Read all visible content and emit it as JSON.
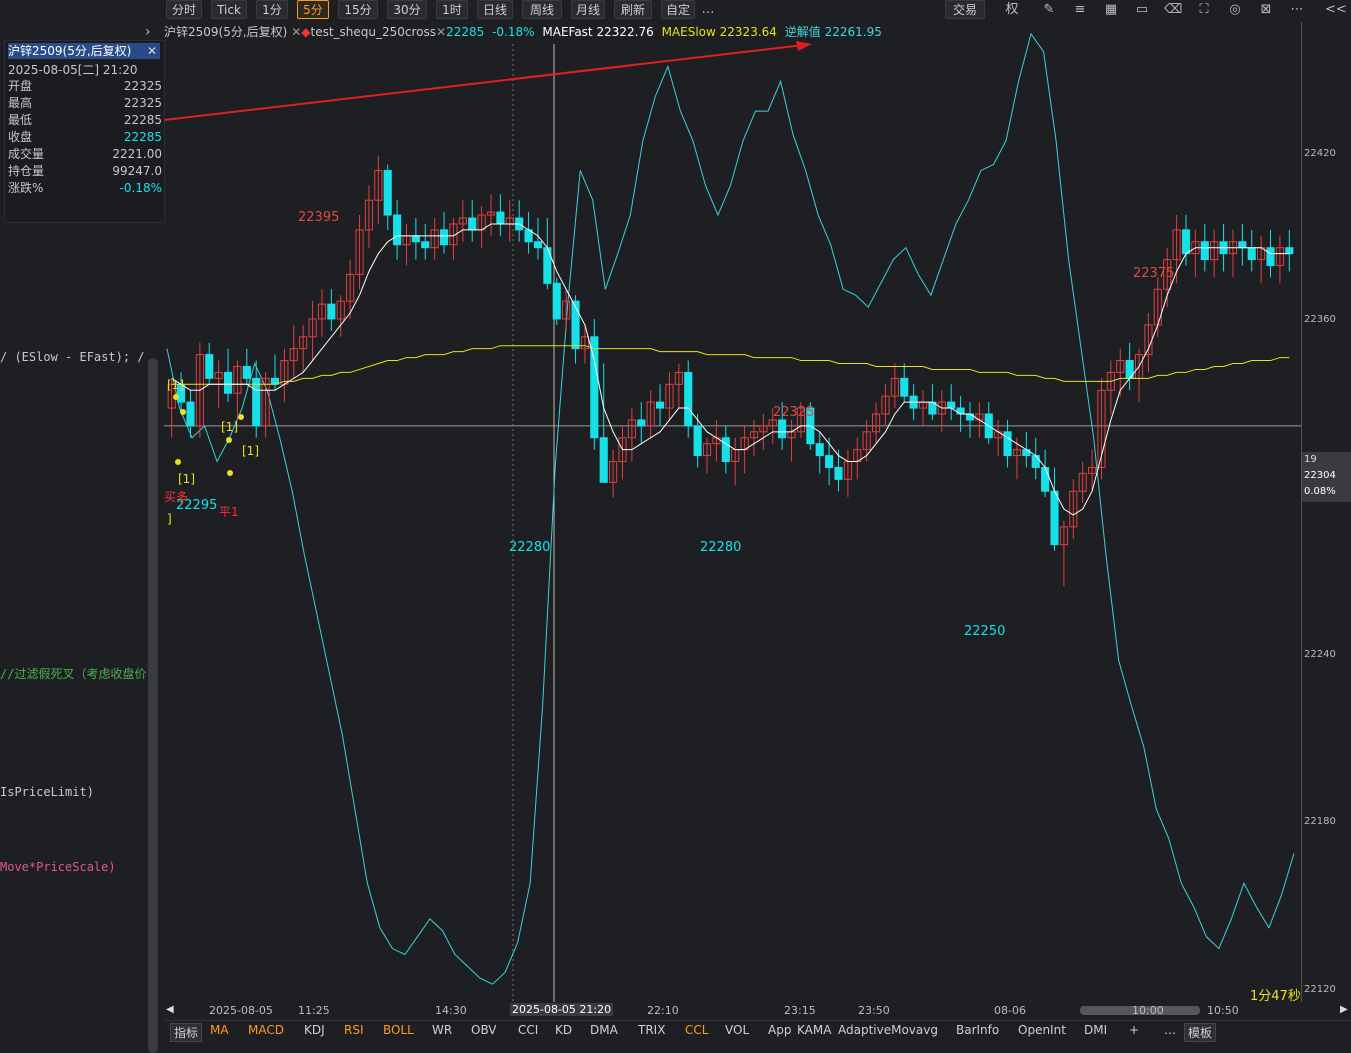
{
  "toolbar": {
    "periods": [
      "分时",
      "Tick",
      "1分",
      "5分",
      "15分",
      "30分",
      "1时",
      "日线",
      "周线",
      "月线",
      "刷新",
      "自定"
    ],
    "active": "5分",
    "more": "…",
    "trade": "交易",
    "right_label": "权",
    "collapse": "<<"
  },
  "info": {
    "title": "沪锌2509(5分,后复权)",
    "datetime": "2025-08-05[二] 21:20",
    "rows": [
      {
        "k": "开盘",
        "v": "22325"
      },
      {
        "k": "最高",
        "v": "22325"
      },
      {
        "k": "最低",
        "v": "22285"
      },
      {
        "k": "收盘",
        "v": "22285"
      },
      {
        "k": "成交量",
        "v": "2221.00"
      },
      {
        "k": "持仓量",
        "v": "99247.0"
      },
      {
        "k": "涨跌%",
        "v": "-0.18%"
      }
    ]
  },
  "code_snippets": [
    "/ (ESlow - EFast);  /",
    "//过滤假死叉（考虑收盘价",
    "IsPriceLimit)",
    "Move*PriceScale)"
  ],
  "header": {
    "symbol": "沪锌2509(5分,后复权)",
    "strategy": "test_shequ_250cross",
    "price": "22285",
    "change": "-0.18%",
    "maefast_label": "MAEFast",
    "maefast": "22322.76",
    "maeslow_label": "MAESlow",
    "maeslow": "22323.64",
    "nijie_label": "逆解值",
    "nijie": "22261.95"
  },
  "annotations": {
    "h1": "22395",
    "h2": "22325",
    "h3": "22375",
    "l0": "22295",
    "l1": "22280",
    "l2": "22280",
    "l3": "22250",
    "sig1": "[1]",
    "sig2": "[1]",
    "sig3": "[1]",
    "sig4": "[1]",
    "sig_buy": "买多",
    "sig_close": "平1",
    "bracket": "]"
  },
  "yaxis": {
    "labels": [
      "22420",
      "22360",
      "22304",
      "22240",
      "22180",
      "22120"
    ],
    "marker_top": "19",
    "marker_pct": "0.08%"
  },
  "xaxis": {
    "labels": [
      "2025-08-05",
      "11:25",
      "14:30",
      "2025-08-05 21:20",
      "22:10",
      "23:15",
      "23:50",
      "08-06",
      "10:00",
      "10:50"
    ]
  },
  "countdown": "1分47秒",
  "indicators": [
    "指标",
    "MA",
    "MACD",
    "KDJ",
    "RSI",
    "BOLL",
    "WR",
    "OBV",
    "CCI",
    "KD",
    "DMA",
    "TRIX",
    "CCL",
    "VOL",
    "App",
    "KAMA",
    "AdaptiveMovavg",
    "BarInfo",
    "OpenInt",
    "DMI",
    "+",
    "…",
    "模板"
  ],
  "colors": {
    "up": "#e04040",
    "down": "#18e0e8",
    "maslow": "#e8e020",
    "mafast": "#ffffff",
    "nijie": "#40d8e0",
    "bg": "#1e1f23",
    "accent": "#ff9a1f"
  },
  "chart_data": {
    "type": "candlestick",
    "y_range": [
      22110,
      22440
    ],
    "price_labels": [
      22420,
      22360,
      22304,
      22240,
      22180,
      22120
    ],
    "candles": [
      [
        22310,
        22320,
        22300,
        22318
      ],
      [
        22318,
        22322,
        22308,
        22312
      ],
      [
        22312,
        22316,
        22300,
        22304
      ],
      [
        22304,
        22332,
        22300,
        22328
      ],
      [
        22328,
        22332,
        22318,
        22320
      ],
      [
        22320,
        22326,
        22310,
        22322
      ],
      [
        22322,
        22330,
        22312,
        22315
      ],
      [
        22315,
        22326,
        22306,
        22324
      ],
      [
        22324,
        22330,
        22318,
        22320
      ],
      [
        22320,
        22326,
        22300,
        22304
      ],
      [
        22304,
        22322,
        22300,
        22320
      ],
      [
        22320,
        22328,
        22316,
        22318
      ],
      [
        22318,
        22330,
        22312,
        22326
      ],
      [
        22326,
        22338,
        22320,
        22330
      ],
      [
        22330,
        22338,
        22322,
        22334
      ],
      [
        22334,
        22346,
        22326,
        22340
      ],
      [
        22340,
        22350,
        22334,
        22345
      ],
      [
        22345,
        22350,
        22336,
        22340
      ],
      [
        22340,
        22348,
        22334,
        22346
      ],
      [
        22346,
        22360,
        22340,
        22355
      ],
      [
        22355,
        22375,
        22350,
        22370
      ],
      [
        22370,
        22385,
        22364,
        22380
      ],
      [
        22380,
        22395,
        22372,
        22390
      ],
      [
        22390,
        22392,
        22370,
        22375
      ],
      [
        22375,
        22380,
        22360,
        22365
      ],
      [
        22365,
        22372,
        22358,
        22368
      ],
      [
        22368,
        22374,
        22360,
        22366
      ],
      [
        22366,
        22372,
        22360,
        22364
      ],
      [
        22364,
        22374,
        22360,
        22370
      ],
      [
        22370,
        22376,
        22362,
        22365
      ],
      [
        22365,
        22374,
        22360,
        22372
      ],
      [
        22372,
        22380,
        22366,
        22374
      ],
      [
        22374,
        22380,
        22366,
        22370
      ],
      [
        22370,
        22378,
        22364,
        22375
      ],
      [
        22375,
        22382,
        22368,
        22376
      ],
      [
        22376,
        22382,
        22368,
        22372
      ],
      [
        22372,
        22380,
        22366,
        22374
      ],
      [
        22374,
        22380,
        22366,
        22370
      ],
      [
        22370,
        22376,
        22362,
        22366
      ],
      [
        22366,
        22374,
        22360,
        22364
      ],
      [
        22364,
        22374,
        22350,
        22352
      ],
      [
        22352,
        22354,
        22338,
        22340
      ],
      [
        22340,
        22350,
        22336,
        22346
      ],
      [
        22346,
        22348,
        22325,
        22330
      ],
      [
        22330,
        22338,
        22325,
        22334
      ],
      [
        22334,
        22340,
        22296,
        22300
      ],
      [
        22300,
        22325,
        22285,
        22285
      ],
      [
        22285,
        22296,
        22280,
        22292
      ],
      [
        22292,
        22304,
        22286,
        22300
      ],
      [
        22300,
        22310,
        22292,
        22306
      ],
      [
        22306,
        22312,
        22298,
        22304
      ],
      [
        22304,
        22316,
        22300,
        22312
      ],
      [
        22312,
        22318,
        22304,
        22310
      ],
      [
        22310,
        22322,
        22306,
        22318
      ],
      [
        22318,
        22325,
        22310,
        22322
      ],
      [
        22322,
        22326,
        22300,
        22304
      ],
      [
        22304,
        22308,
        22290,
        22294
      ],
      [
        22294,
        22300,
        22288,
        22298
      ],
      [
        22298,
        22306,
        22292,
        22300
      ],
      [
        22300,
        22304,
        22288,
        22292
      ],
      [
        22292,
        22300,
        22284,
        22296
      ],
      [
        22296,
        22304,
        22288,
        22300
      ],
      [
        22300,
        22306,
        22294,
        22302
      ],
      [
        22302,
        22308,
        22296,
        22304
      ],
      [
        22304,
        22310,
        22298,
        22306
      ],
      [
        22306,
        22312,
        22296,
        22300
      ],
      [
        22300,
        22306,
        22292,
        22302
      ],
      [
        22302,
        22312,
        22300,
        22310
      ],
      [
        22310,
        22312,
        22296,
        22298
      ],
      [
        22298,
        22302,
        22288,
        22294
      ],
      [
        22294,
        22300,
        22284,
        22290
      ],
      [
        22290,
        22296,
        22282,
        22286
      ],
      [
        22286,
        22296,
        22280,
        22292
      ],
      [
        22292,
        22300,
        22286,
        22296
      ],
      [
        22296,
        22306,
        22292,
        22302
      ],
      [
        22302,
        22312,
        22298,
        22308
      ],
      [
        22308,
        22318,
        22304,
        22314
      ],
      [
        22314,
        22325,
        22310,
        22320
      ],
      [
        22320,
        22325,
        22312,
        22314
      ],
      [
        22314,
        22318,
        22306,
        22310
      ],
      [
        22310,
        22316,
        22304,
        22312
      ],
      [
        22312,
        22318,
        22306,
        22308
      ],
      [
        22308,
        22316,
        22302,
        22312
      ],
      [
        22312,
        22318,
        22306,
        22310
      ],
      [
        22310,
        22314,
        22302,
        22308
      ],
      [
        22308,
        22312,
        22300,
        22306
      ],
      [
        22306,
        22312,
        22300,
        22308
      ],
      [
        22308,
        22312,
        22298,
        22300
      ],
      [
        22300,
        22306,
        22294,
        22302
      ],
      [
        22302,
        22306,
        22290,
        22294
      ],
      [
        22294,
        22300,
        22286,
        22296
      ],
      [
        22296,
        22302,
        22290,
        22294
      ],
      [
        22294,
        22300,
        22286,
        22290
      ],
      [
        22290,
        22296,
        22280,
        22282
      ],
      [
        22282,
        22290,
        22262,
        22264
      ],
      [
        22264,
        22272,
        22250,
        22270
      ],
      [
        22270,
        22286,
        22266,
        22282
      ],
      [
        22282,
        22292,
        22278,
        22288
      ],
      [
        22288,
        22296,
        22282,
        22290
      ],
      [
        22290,
        22320,
        22286,
        22316
      ],
      [
        22316,
        22326,
        22308,
        22322
      ],
      [
        22322,
        22330,
        22314,
        22326
      ],
      [
        22326,
        22332,
        22316,
        22320
      ],
      [
        22320,
        22330,
        22312,
        22328
      ],
      [
        22328,
        22342,
        22322,
        22338
      ],
      [
        22338,
        22354,
        22334,
        22350
      ],
      [
        22350,
        22364,
        22344,
        22360
      ],
      [
        22360,
        22375,
        22352,
        22370
      ],
      [
        22370,
        22375,
        22358,
        22362
      ],
      [
        22362,
        22370,
        22354,
        22366
      ],
      [
        22366,
        22372,
        22356,
        22360
      ],
      [
        22360,
        22370,
        22354,
        22366
      ],
      [
        22366,
        22372,
        22356,
        22362
      ],
      [
        22362,
        22370,
        22354,
        22366
      ],
      [
        22366,
        22372,
        22358,
        22364
      ],
      [
        22364,
        22370,
        22356,
        22360
      ],
      [
        22360,
        22368,
        22352,
        22364
      ],
      [
        22364,
        22370,
        22354,
        22358
      ],
      [
        22358,
        22368,
        22352,
        22364
      ],
      [
        22364,
        22370,
        22356,
        22362
      ]
    ],
    "mafast": [
      22320,
      22318,
      22316,
      22316,
      22318,
      22318,
      22318,
      22318,
      22318,
      22316,
      22316,
      22316,
      22318,
      22320,
      22322,
      22326,
      22330,
      22334,
      22338,
      22342,
      22348,
      22356,
      22362,
      22366,
      22368,
      22368,
      22368,
      22368,
      22368,
      22368,
      22368,
      22370,
      22370,
      22370,
      22372,
      22372,
      22372,
      22372,
      22370,
      22368,
      22364,
      22356,
      22350,
      22344,
      22338,
      22326,
      22310,
      22302,
      22296,
      22296,
      22298,
      22300,
      22302,
      22306,
      22310,
      22310,
      22306,
      22302,
      22300,
      22298,
      22296,
      22296,
      22298,
      22300,
      22302,
      22302,
      22302,
      22304,
      22304,
      22302,
      22298,
      22294,
      22292,
      22292,
      22294,
      22298,
      22302,
      22308,
      22312,
      22312,
      22312,
      22312,
      22310,
      22310,
      22308,
      22308,
      22306,
      22304,
      22302,
      22300,
      22298,
      22296,
      22294,
      22290,
      22282,
      22276,
      22274,
      22276,
      22282,
      22294,
      22306,
      22316,
      22320,
      22324,
      22330,
      22338,
      22348,
      22356,
      22362,
      22364,
      22364,
      22364,
      22364,
      22364,
      22364,
      22364,
      22364,
      22362,
      22362,
      22362
    ],
    "maslow": [
      22318,
      22318,
      22318,
      22318,
      22318,
      22318,
      22318,
      22318,
      22318,
      22318,
      22318,
      22318,
      22319,
      22319,
      22320,
      22320,
      22321,
      22321,
      22322,
      22322,
      22323,
      22324,
      22325,
      22326,
      22326,
      22327,
      22327,
      22328,
      22328,
      22328,
      22329,
      22329,
      22330,
      22330,
      22330,
      22331,
      22331,
      22331,
      22331,
      22331,
      22331,
      22331,
      22331,
      22331,
      22331,
      22330,
      22330,
      22330,
      22330,
      22330,
      22330,
      22330,
      22329,
      22329,
      22329,
      22329,
      22329,
      22328,
      22328,
      22328,
      22328,
      22328,
      22327,
      22327,
      22327,
      22327,
      22327,
      22326,
      22326,
      22326,
      22326,
      22325,
      22325,
      22325,
      22325,
      22324,
      22324,
      22324,
      22324,
      22324,
      22324,
      22323,
      22323,
      22323,
      22323,
      22323,
      22322,
      22322,
      22322,
      22322,
      22321,
      22321,
      22321,
      22320,
      22320,
      22319,
      22319,
      22319,
      22319,
      22319,
      22319,
      22320,
      22320,
      22320,
      22320,
      22321,
      22321,
      22322,
      22322,
      22323,
      22323,
      22324,
      22324,
      22325,
      22325,
      22326,
      22326,
      22326,
      22327,
      22327
    ]
  }
}
